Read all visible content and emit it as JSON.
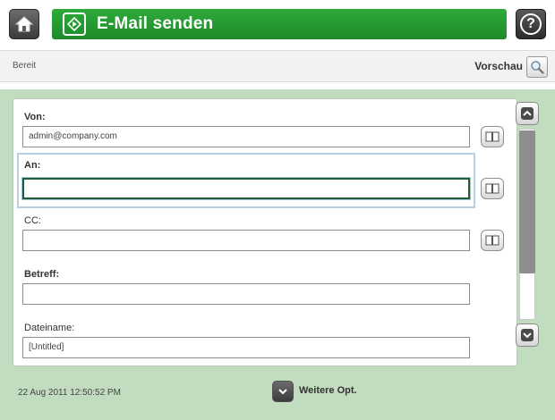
{
  "header": {
    "title": "E-Mail senden",
    "help_symbol": "?"
  },
  "status": {
    "text": "Bereit",
    "preview_label": "Vorschau"
  },
  "form": {
    "from": {
      "label": "Von:",
      "value": "admin@company.com"
    },
    "to": {
      "label": "An:",
      "value": ""
    },
    "cc": {
      "label": "CC:",
      "value": ""
    },
    "subject": {
      "label": "Betreff:",
      "value": ""
    },
    "filename": {
      "label": "Dateiname:",
      "value": "[Untitled]"
    }
  },
  "footer": {
    "timestamp": "22 Aug 2011 12:50:52 PM",
    "more_options_label": "Weitere Opt."
  },
  "icons": {
    "home": "home-icon",
    "title": "email-send-icon",
    "help": "help-icon",
    "preview": "magnifier-icon",
    "address_book": "address-book-icon",
    "scroll_up": "chevron-up-icon",
    "scroll_down": "chevron-down-icon",
    "more": "chevron-down-icon"
  },
  "colors": {
    "title_bar": "#2eaa3a",
    "panel_background": "#c2dcc0",
    "active_field_border": "#1f5f37"
  }
}
